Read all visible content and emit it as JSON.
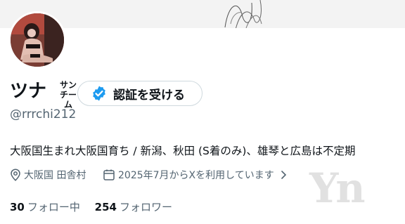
{
  "profile": {
    "display_name": "ツナ",
    "name_ruby_top": "サン",
    "name_ruby_bottom": "チーム",
    "handle": "@rrrchi212",
    "bio": "大阪国生まれ大阪国育ち / 新潟、秋田 (S着のみ)、雄琴と広島は不定期",
    "location": "大阪国 田舎村",
    "joined": "2025年7月からXを利用しています",
    "following_count": "30",
    "following_label": "フォロー中",
    "followers_count": "254",
    "followers_label": "フォロワー"
  },
  "verify_button": {
    "label": "認証を受ける"
  },
  "icons": {
    "verified": "verified-badge-icon",
    "location": "location-pin-icon",
    "calendar": "calendar-icon",
    "chevron": "chevron-right-icon"
  },
  "watermark": "Yn",
  "colors": {
    "accent": "#1d9bf0",
    "muted": "#536471",
    "text": "#0f1419"
  }
}
